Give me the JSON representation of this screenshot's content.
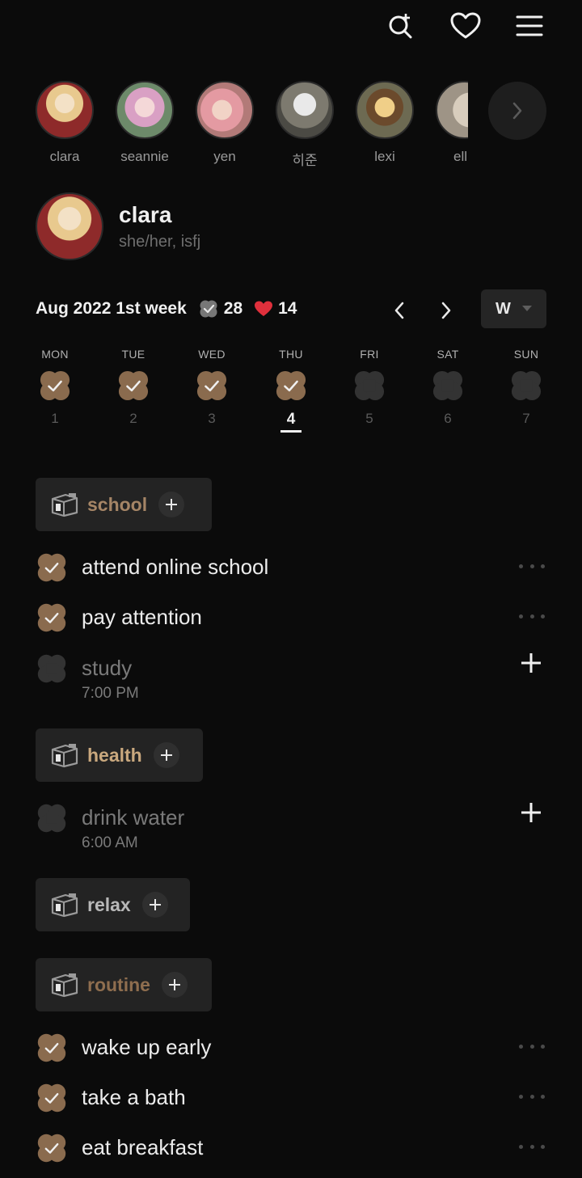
{
  "topbar": {
    "icons": [
      "search-add-icon",
      "heart-icon",
      "menu-icon"
    ]
  },
  "friends": [
    {
      "name": "clara"
    },
    {
      "name": "seannie"
    },
    {
      "name": "yen"
    },
    {
      "name": "히준"
    },
    {
      "name": "lexi"
    },
    {
      "name": "ell"
    }
  ],
  "profile": {
    "name": "clara",
    "subtitle": "she/her, isfj"
  },
  "week": {
    "title": "Aug 2022 1st week",
    "checks": "28",
    "hearts": "14",
    "view": "W"
  },
  "days": [
    {
      "label": "MON",
      "num": "1",
      "state": "done"
    },
    {
      "label": "TUE",
      "num": "2",
      "state": "done"
    },
    {
      "label": "WED",
      "num": "3",
      "state": "done"
    },
    {
      "label": "THU",
      "num": "4",
      "state": "done-today"
    },
    {
      "label": "FRI",
      "num": "5",
      "state": "empty"
    },
    {
      "label": "SAT",
      "num": "6",
      "state": "empty"
    },
    {
      "label": "SUN",
      "num": "7",
      "state": "empty"
    }
  ],
  "categories": {
    "school": {
      "label": "school",
      "color": "#a58566"
    },
    "health": {
      "label": "health",
      "color": "#c9a87e"
    },
    "relax": {
      "label": "relax",
      "color": "#b8b8b8"
    },
    "routine": {
      "label": "routine",
      "color": "#8f6e4f"
    }
  },
  "tasks": {
    "school": [
      {
        "text": "attend online school",
        "done": true
      },
      {
        "text": "pay attention",
        "done": true
      },
      {
        "text": "study",
        "done": false,
        "time": "7:00 PM"
      }
    ],
    "health": [
      {
        "text": "drink water",
        "done": false,
        "time": "6:00 AM"
      }
    ],
    "routine": [
      {
        "text": "wake up early",
        "done": true
      },
      {
        "text": "take a bath",
        "done": true
      },
      {
        "text": "eat breakfast",
        "done": true
      }
    ]
  },
  "colors": {
    "done": "#8a6b4e",
    "empty": "#333333",
    "heart": "#e0303c"
  }
}
